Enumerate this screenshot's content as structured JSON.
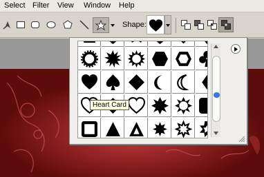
{
  "menu": {
    "items": [
      "Select",
      "Filter",
      "View",
      "Window",
      "Help"
    ]
  },
  "options_bar": {
    "shape_label": "Shape:",
    "tools": [
      "pen-icon",
      "rectangle-icon",
      "rounded-rectangle-icon",
      "ellipse-icon",
      "polygon-icon",
      "line-icon",
      "custom-shape-icon"
    ],
    "modes": [
      "add-mode-icon",
      "subtract-mode-icon",
      "intersect-mode-icon",
      "exclude-mode-icon"
    ]
  },
  "shape_picker": {
    "selected": "Heart Card",
    "tooltip": "Heart Card",
    "shapes": [
      "shape-partial",
      "shape-partial",
      "shape-partial",
      "shape-partial",
      "shape-partial",
      "circle-frame",
      "starburst-16",
      "starburst-20",
      "hexagon",
      "hexagon-frame",
      "club",
      "heart",
      "spade",
      "diamond",
      "crescent",
      "crescent-frame",
      "diamond-small",
      "heart-frame",
      "diamond-frame",
      "heart-frame-alt",
      "seal-8",
      "seal-frame",
      "rounded-square",
      "square-frame",
      "triangle",
      "triangle-frame",
      "seal-small",
      "seal-frame-small",
      "seal-outline"
    ]
  },
  "colors": {
    "accent": "#3a7ad9",
    "canvas": "#8b1a1a",
    "tooltip_bg": "#ffffe1"
  }
}
